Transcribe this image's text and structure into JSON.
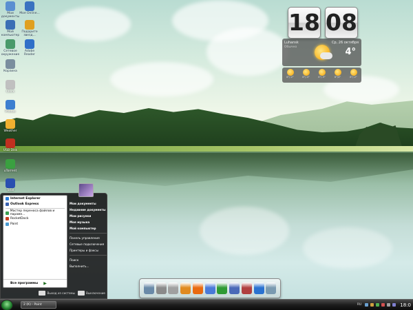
{
  "desktop": {
    "icons_left": [
      {
        "label": "Мои документы",
        "color": "#5a8fd1"
      },
      {
        "label": "Мой компьютер",
        "color": "#3a6fb5"
      },
      {
        "label": "Сетевое окружение",
        "color": "#4a9a6a"
      },
      {
        "label": "Корзина",
        "color": "#7a8e9e"
      },
      {
        "label": "Clock",
        "color": "#c0c0c0"
      },
      {
        "label": "Photos",
        "color": "#3d7fd0"
      },
      {
        "label": "Weather",
        "color": "#f0b030"
      },
      {
        "label": "USB Disk",
        "color": "#c03020"
      },
      {
        "label": "uTorrent",
        "color": "#3aa040"
      },
      {
        "label": "Total",
        "color": "#2a4fb0"
      }
    ],
    "icons_right": [
      {
        "label": "Моя Online...",
        "color": "#3a72c0"
      },
      {
        "label": "Подарите звезд...",
        "color": "#e0a020"
      },
      {
        "label": "Adobe Reader",
        "color": "#3070c8"
      }
    ]
  },
  "clock_gadget": {
    "hours": "18",
    "minutes": "08"
  },
  "weather": {
    "city": "Luhansk",
    "condition": "Обычно",
    "date": "Ср, 26 октября",
    "temperature": "4°",
    "forecast": [
      "8°/-2°",
      "8°/-4°",
      "6°/-3°",
      "8°/4°",
      "8°/-2°"
    ]
  },
  "start_menu": {
    "pinned": [
      {
        "label": "Internet Explorer",
        "color": "#2a7fd8"
      },
      {
        "label": "Outlook Express",
        "color": "#3a62b0"
      }
    ],
    "recent": [
      {
        "label": "Мастер переноса файлов и параме...",
        "color": "#3aa050"
      },
      {
        "label": "RocketDock",
        "color": "#c84020"
      },
      {
        "label": "Paint",
        "color": "#4a9ad0"
      }
    ],
    "all_programs": "Все программы",
    "right_items": [
      {
        "label": "Мои документы",
        "bold": true
      },
      {
        "label": "Недавние документы",
        "bold": true
      },
      {
        "label": "Мои рисунки",
        "bold": true
      },
      {
        "label": "Моя музыка",
        "bold": true
      },
      {
        "label": "Мой компьютер",
        "bold": true
      },
      {
        "label": "Панель управления",
        "bold": false
      },
      {
        "label": "Сетевые подключения",
        "bold": false
      },
      {
        "label": "Принтеры и факсы",
        "bold": false
      },
      {
        "label": "Поиск",
        "bold": false
      },
      {
        "label": "Выполнить...",
        "bold": false
      }
    ],
    "logoff_label": "Выход из системы",
    "shutdown_label": "Выключение"
  },
  "dock": {
    "items": [
      {
        "name": "computer",
        "color": "#6a8aa8"
      },
      {
        "name": "disk",
        "color": "#8a8a8a"
      },
      {
        "name": "tools",
        "color": "#a0a0a0"
      },
      {
        "name": "folder",
        "color": "#e08a20"
      },
      {
        "name": "firefox",
        "color": "#e86a10"
      },
      {
        "name": "ie",
        "color": "#4a7ad8"
      },
      {
        "name": "utorrent",
        "color": "#2e9a34"
      },
      {
        "name": "docs",
        "color": "#4a6ab8"
      },
      {
        "name": "books",
        "color": "#b04040"
      },
      {
        "name": "globe",
        "color": "#2a72d0"
      },
      {
        "name": "trash",
        "color": "#7a9ab0"
      }
    ]
  },
  "taskbar": {
    "task_label": "2 (К) - Paint",
    "language": "RU",
    "time": "18:0",
    "tray": [
      "#6aa0d0",
      "#d0a040",
      "#50b050",
      "#d05050",
      "#a0a0a0",
      "#8080d0"
    ]
  }
}
